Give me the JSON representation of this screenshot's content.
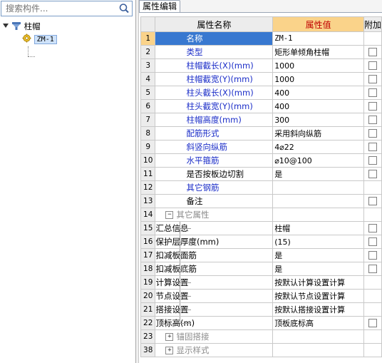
{
  "search": {
    "placeholder": "搜索构件...",
    "icon": "search-icon"
  },
  "tree": {
    "root": {
      "label": "柱帽",
      "icon": "column-cap-icon"
    },
    "child": {
      "label": "ZM-1",
      "icon": "gear-icon"
    }
  },
  "tab": {
    "label": "属性编辑"
  },
  "grid": {
    "headers": {
      "name": "属性名称",
      "value": "属性值",
      "add": "附加"
    },
    "rows": [
      {
        "num": "1",
        "name": "名称",
        "value": "ZM-1"
      },
      {
        "num": "2",
        "name": "类型",
        "value": "矩形单倾角柱帽"
      },
      {
        "num": "3",
        "name": "柱帽截长(X)(mm)",
        "value": "1000"
      },
      {
        "num": "4",
        "name": "柱帽截宽(Y)(mm)",
        "value": "1000"
      },
      {
        "num": "5",
        "name": "柱头截长(X)(mm)",
        "value": "400"
      },
      {
        "num": "6",
        "name": "柱头截宽(Y)(mm)",
        "value": "400"
      },
      {
        "num": "7",
        "name": "柱帽高度(mm)",
        "value": "300"
      },
      {
        "num": "8",
        "name": "配筋形式",
        "value": "采用斜向纵筋"
      },
      {
        "num": "9",
        "name": "斜竖向纵筋",
        "value": "4⌀22"
      },
      {
        "num": "10",
        "name": "水平箍筋",
        "value": "⌀10@100"
      },
      {
        "num": "11",
        "name": "是否按板边切割",
        "value": "是"
      },
      {
        "num": "12",
        "name": "其它钢筋",
        "value": ""
      },
      {
        "num": "13",
        "name": "备注",
        "value": ""
      },
      {
        "num": "14",
        "name": "其它属性",
        "value": ""
      },
      {
        "num": "15",
        "name": "汇总信息",
        "value": "柱帽"
      },
      {
        "num": "16",
        "name": "保护层厚度(mm)",
        "value": "(15)"
      },
      {
        "num": "17",
        "name": "扣减板面筋",
        "value": "是"
      },
      {
        "num": "18",
        "name": "扣减板底筋",
        "value": "是"
      },
      {
        "num": "19",
        "name": "计算设置",
        "value": "按默认计算设置计算"
      },
      {
        "num": "20",
        "name": "节点设置",
        "value": "按默认节点设置计算"
      },
      {
        "num": "21",
        "name": "搭接设置",
        "value": "按默认搭接设置计算"
      },
      {
        "num": "22",
        "name": "顶标高(m)",
        "value": "顶板底标高"
      },
      {
        "num": "23",
        "name": "锚固搭接",
        "value": ""
      },
      {
        "num": "38",
        "name": "显示样式",
        "value": ""
      }
    ]
  }
}
